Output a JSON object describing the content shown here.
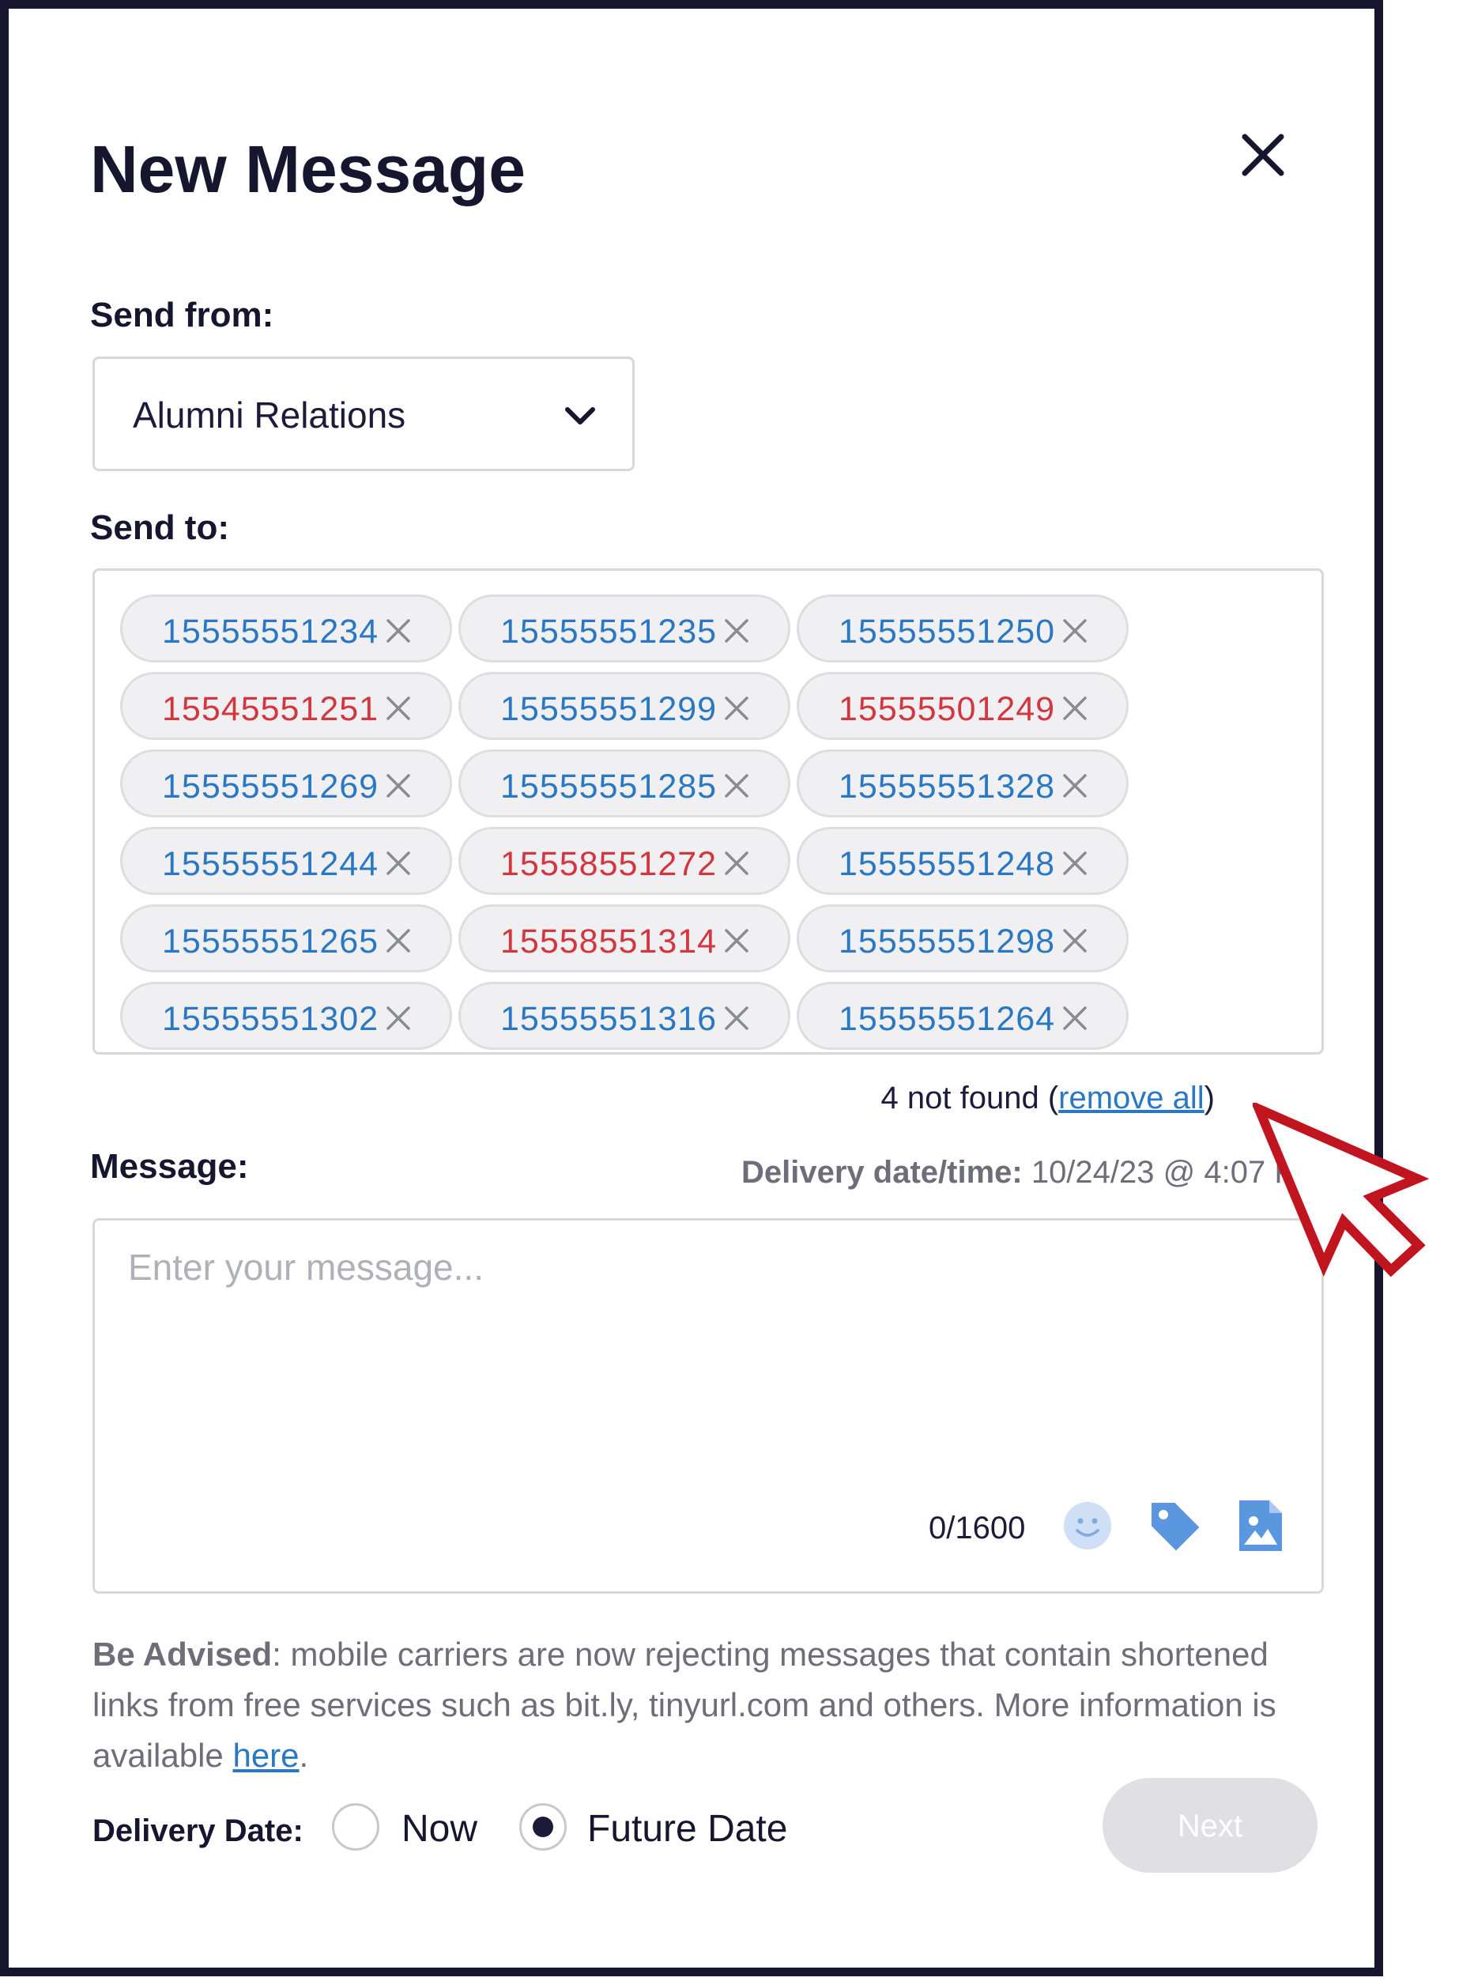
{
  "dialog": {
    "title": "New Message",
    "send_from_label": "Send from:",
    "send_from_value": "Alumni Relations",
    "send_to_label": "Send to:",
    "recipients": [
      {
        "number": "15555551234",
        "status": "ok"
      },
      {
        "number": "15555551235",
        "status": "ok"
      },
      {
        "number": "15555551250",
        "status": "ok"
      },
      {
        "number": "15545551251",
        "status": "not_found"
      },
      {
        "number": "15555551299",
        "status": "ok"
      },
      {
        "number": "15555501249",
        "status": "not_found"
      },
      {
        "number": "15555551269",
        "status": "ok"
      },
      {
        "number": "15555551285",
        "status": "ok"
      },
      {
        "number": "15555551328",
        "status": "ok"
      },
      {
        "number": "15555551244",
        "status": "ok"
      },
      {
        "number": "15558551272",
        "status": "not_found"
      },
      {
        "number": "15555551248",
        "status": "ok"
      },
      {
        "number": "15555551265",
        "status": "ok"
      },
      {
        "number": "15558551314",
        "status": "not_found"
      },
      {
        "number": "15555551298",
        "status": "ok"
      },
      {
        "number": "15555551302",
        "status": "ok"
      },
      {
        "number": "15555551316",
        "status": "ok"
      },
      {
        "number": "15555551264",
        "status": "ok"
      }
    ],
    "not_found_text": "4 not found (",
    "remove_all_label": "remove all",
    "not_found_close": ")",
    "message_label": "Message:",
    "delivery_label": "Delivery date/time:",
    "delivery_value": " 10/24/23 @ 4:07 P",
    "message_placeholder": "Enter your message...",
    "char_count": "0/1600",
    "advise_bold": "Be Advised",
    "advise_text": ": mobile carriers are now rejecting messages that contain shortened links from free services such as bit.ly, tinyurl.com and others. More information is available ",
    "advise_link": "here",
    "advise_end": ".",
    "delivery_date_label": "Delivery Date:",
    "option_now": "Now",
    "option_future": "Future Date",
    "selected_option": "Future Date",
    "next_label": "Next"
  },
  "colors": {
    "ok_number": "#2a78c4",
    "not_found_number": "#d2363f",
    "cursor_annotation": "#c0141f"
  },
  "icons": [
    "close-icon",
    "chevron-down-icon",
    "remove-x-icon",
    "emoji-icon",
    "tag-icon",
    "image-icon",
    "pointer-cursor-icon"
  ]
}
